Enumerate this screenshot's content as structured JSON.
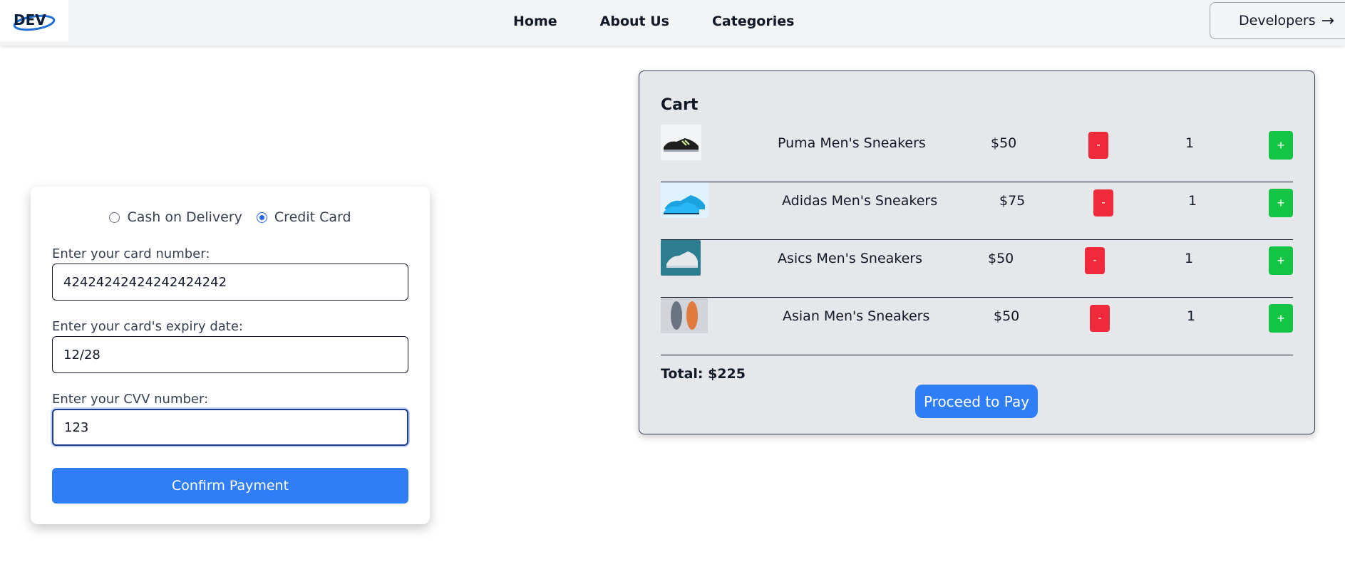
{
  "nav": {
    "logo_text": "DEV",
    "links": [
      "Home",
      "About Us",
      "Categories"
    ],
    "developers_label": "Developers",
    "developers_icon": "arrow-right-icon"
  },
  "payment": {
    "methods": [
      {
        "label": "Cash on Delivery",
        "selected": false
      },
      {
        "label": "Credit Card",
        "selected": true
      }
    ],
    "card_number_label": "Enter your card number:",
    "card_number_value": "42424242424242424242",
    "expiry_label": "Enter your card's expiry date:",
    "expiry_value": "12/28",
    "cvv_label": "Enter your CVV number:",
    "cvv_value": "123",
    "confirm_label": "Confirm Payment"
  },
  "cart": {
    "title": "Cart",
    "minus_label": "-",
    "plus_label": "+",
    "items": [
      {
        "name": "Puma Men's Sneakers",
        "price": "$50",
        "qty": "1"
      },
      {
        "name": "Adidas Men's Sneakers",
        "price": "$75",
        "qty": "1"
      },
      {
        "name": "Asics Men's Sneakers",
        "price": "$50",
        "qty": "1"
      },
      {
        "name": "Asian Men's Sneakers",
        "price": "$50",
        "qty": "1"
      }
    ],
    "total": "Total: $225",
    "proceed_label": "Proceed to Pay"
  },
  "colors": {
    "primary": "#2f7ef7",
    "minus": "#ef2b3b",
    "plus": "#14c545",
    "navbar": "#f3f4f6",
    "cart_bg": "#e5e7eb"
  }
}
